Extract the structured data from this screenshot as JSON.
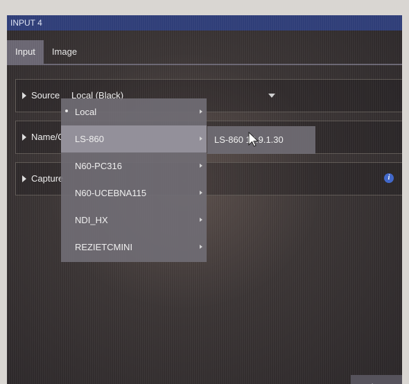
{
  "window": {
    "title": "INPUT 4"
  },
  "tabs": [
    {
      "label": "Input",
      "active": true
    },
    {
      "label": "Image",
      "active": false
    }
  ],
  "sections": {
    "source": {
      "label": "Source",
      "value": "Local (Black)"
    },
    "name": {
      "label": "Name/C"
    },
    "capture": {
      "label": "Capture"
    }
  },
  "source_menu": {
    "items": [
      {
        "label": "Local",
        "selected": true
      },
      {
        "label": "LS-860",
        "highlighted": true
      },
      {
        "label": "N60-PC316"
      },
      {
        "label": "N60-UCEBNA115"
      },
      {
        "label": "NDI_HX"
      },
      {
        "label": "REZIETCMINI"
      }
    ],
    "submenu": {
      "label": "LS-860 10.9.1.30"
    }
  },
  "footer": {
    "close_label": "Close"
  },
  "colors": {
    "titlebar": "#2f3e78",
    "info_icon": "#3f66c9",
    "menu_bg": "#706c74"
  }
}
